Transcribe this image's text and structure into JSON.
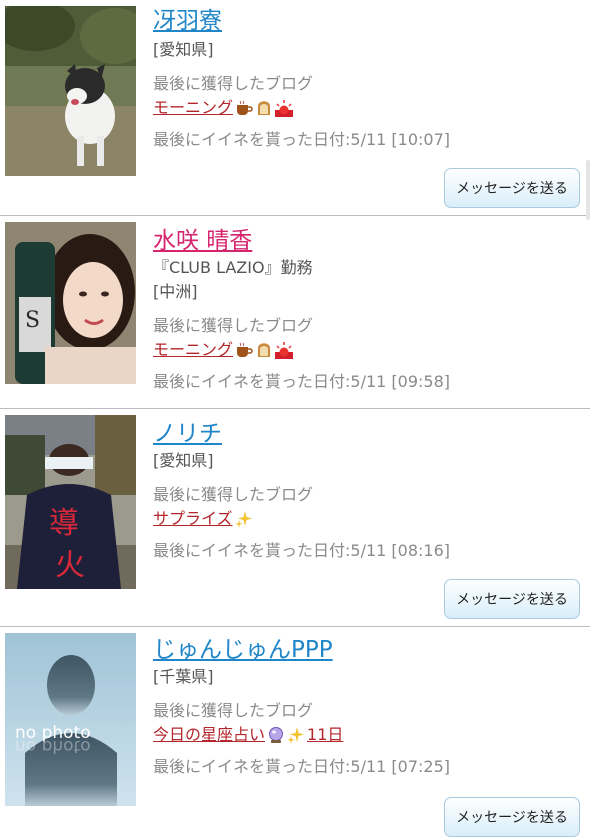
{
  "common": {
    "last_blog_label": "最後に獲得したブログ",
    "like_date_prefix": "最後にイイネを貰った日付:",
    "message_button": "メッセージを送る"
  },
  "users": [
    {
      "name": "冴羽寮",
      "name_color": "#2086c9",
      "details": [
        "[愛知県]"
      ],
      "blog_title": "モーニング",
      "blog_icons": [
        "coffee-cup-icon",
        "toast-icon",
        "sunrise-icon"
      ],
      "blog_suffix": "",
      "like_date": "5/11 [10:07]",
      "photo": "dog-photo",
      "has_message_button": true
    },
    {
      "name": "水咲 晴香",
      "name_color": "#d6246e",
      "details": [
        "『CLUB LAZIO』勤務",
        "[中洲]"
      ],
      "blog_title": "モーニング",
      "blog_icons": [
        "coffee-cup-icon",
        "toast-icon",
        "sunrise-icon"
      ],
      "blog_suffix": "",
      "like_date": "5/11 [09:58]",
      "photo": "woman-with-bottle-photo",
      "has_message_button": false
    },
    {
      "name": "ノリチ",
      "name_color": "#2086c9",
      "details": [
        "[愛知県]"
      ],
      "blog_title": "サプライズ",
      "blog_icons": [
        "sparkle-icon"
      ],
      "blog_suffix": "",
      "like_date": "5/11 [08:16]",
      "photo": "festival-man-photo",
      "has_message_button": true
    },
    {
      "name": "じゅんじゅんPPP",
      "name_color": "#2086c9",
      "details": [
        "[千葉県]"
      ],
      "blog_title": "今日の星座占い",
      "blog_icons": [
        "crystal-ball-icon",
        "sparkle-icon"
      ],
      "blog_suffix": "11日",
      "like_date": "5/11 [07:25]",
      "photo": "no-photo-placeholder",
      "photo_text": "no photo",
      "has_message_button": true
    }
  ]
}
